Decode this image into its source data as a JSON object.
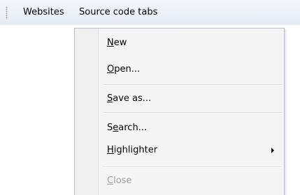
{
  "menubar": {
    "items": [
      {
        "label": "Websites"
      },
      {
        "label": "Source code tabs"
      }
    ]
  },
  "dropdown": {
    "items": [
      {
        "mnemonic": "N",
        "rest": "ew"
      },
      {
        "mnemonic": "O",
        "rest": "pen..."
      },
      {
        "mnemonic": "S",
        "rest": "ave as..."
      },
      {
        "pre": "S",
        "mnemonic": "e",
        "rest": "arch..."
      },
      {
        "mnemonic": "H",
        "rest": "ighlighter"
      },
      {
        "mnemonic": "C",
        "rest": "lose",
        "disabled": true
      }
    ]
  }
}
